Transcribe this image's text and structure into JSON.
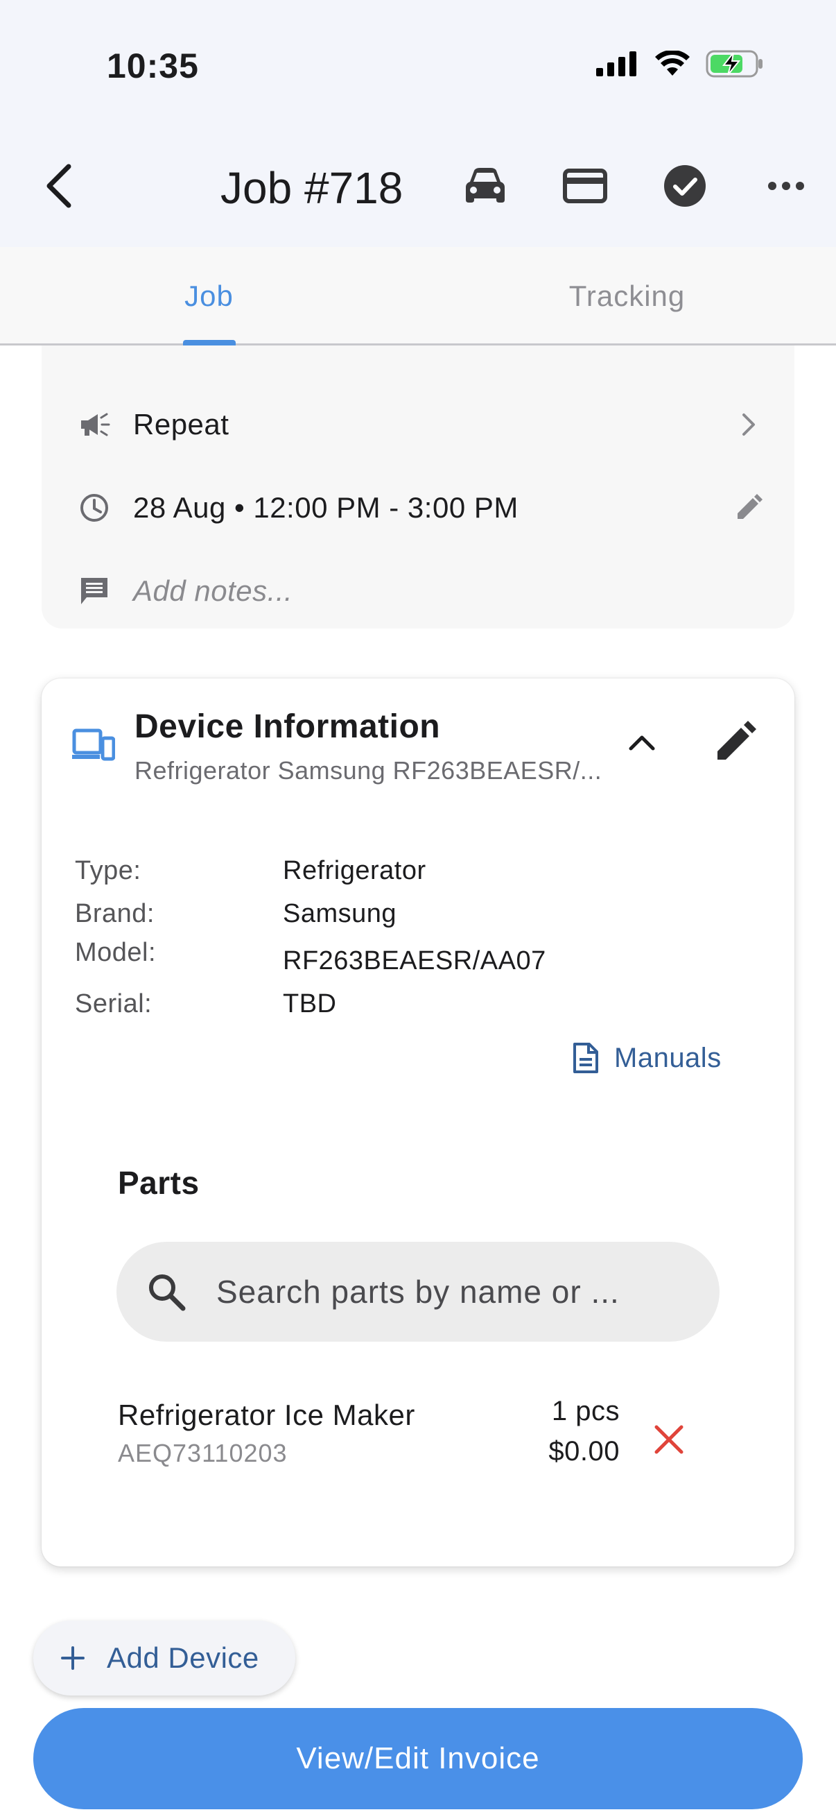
{
  "status_bar": {
    "time": "10:35"
  },
  "nav": {
    "title": "Job #718",
    "icons": [
      "back-icon",
      "car-icon",
      "credit-card-icon",
      "check-circle-icon",
      "more-icon"
    ]
  },
  "tabs": [
    {
      "label": "Job",
      "active": true
    },
    {
      "label": "Tracking",
      "active": false
    }
  ],
  "summary": {
    "source": "Repeat",
    "schedule": "28 Aug • 12:00 PM - 3:00 PM",
    "notes_placeholder": "Add notes..."
  },
  "device": {
    "title": "Device Information",
    "subtitle": "Refrigerator Samsung RF263BEAESR/...",
    "specs": [
      {
        "label": "Type:",
        "value": "Refrigerator"
      },
      {
        "label": "Brand:",
        "value": "Samsung"
      },
      {
        "label": "Model:",
        "value": "RF263BEAESR/AA07"
      },
      {
        "label": "Serial:",
        "value": "TBD"
      }
    ],
    "manuals_label": "Manuals",
    "parts": {
      "title": "Parts",
      "search_placeholder": "Search parts by name or ...",
      "items": [
        {
          "name": "Refrigerator Ice Maker",
          "code": "AEQ73110203",
          "qty": "1 pcs",
          "price": "$0.00"
        }
      ]
    }
  },
  "actions": {
    "add_device": "Add Device",
    "invoice": "View/Edit Invoice"
  },
  "colors": {
    "accent": "#4a8fe0",
    "link": "#335e96",
    "remove": "#e0443a",
    "button": "#4a90e8"
  }
}
